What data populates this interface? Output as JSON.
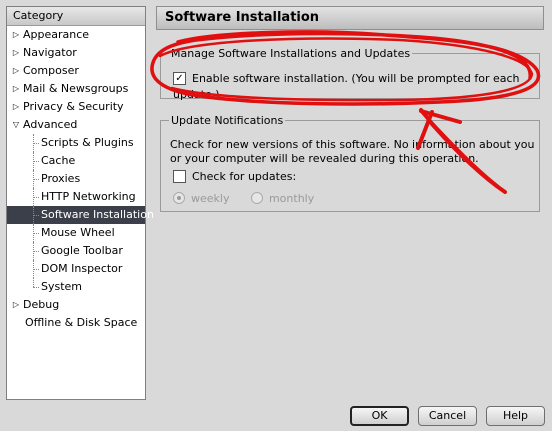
{
  "sidebar": {
    "header": "Category",
    "items": [
      {
        "label": "Appearance",
        "twisty": "▷"
      },
      {
        "label": "Navigator",
        "twisty": "▷"
      },
      {
        "label": "Composer",
        "twisty": "▷"
      },
      {
        "label": "Mail & Newsgroups",
        "twisty": "▷"
      },
      {
        "label": "Privacy & Security",
        "twisty": "▷"
      },
      {
        "label": "Advanced",
        "twisty": "▽"
      },
      {
        "label": "Scripts & Plugins"
      },
      {
        "label": "Cache"
      },
      {
        "label": "Proxies"
      },
      {
        "label": "HTTP Networking"
      },
      {
        "label": "Software Installation"
      },
      {
        "label": "Mouse Wheel"
      },
      {
        "label": "Google Toolbar"
      },
      {
        "label": "DOM Inspector"
      },
      {
        "label": "System"
      },
      {
        "label": "Debug",
        "twisty": "▷"
      },
      {
        "label": "Offline & Disk Space"
      }
    ],
    "selected": "Software Installation"
  },
  "main": {
    "title": "Software Installation",
    "manage_group": {
      "legend": "Manage Software Installations and Updates",
      "checkbox_label": "Enable software installation. (You will be prompted for each update.)",
      "checkbox_mark": "✓"
    },
    "update_group": {
      "legend": "Update Notifications",
      "description": "Check for new versions of this software. No information about you or your computer will be revealed during this operation.",
      "checkbox_label": "Check for updates:",
      "radio_weekly": "weekly",
      "radio_monthly": "monthly"
    }
  },
  "buttons": {
    "ok": "OK",
    "cancel": "Cancel",
    "help": "Help"
  },
  "colors": {
    "annotation": "#e01010",
    "selected_row": "#3a3f4a"
  }
}
